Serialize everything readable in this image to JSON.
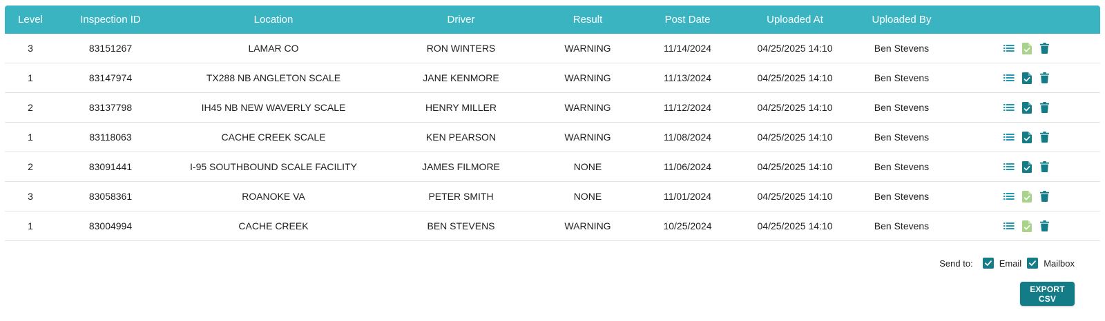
{
  "table": {
    "columns": [
      "Level",
      "Inspection ID",
      "Location",
      "Driver",
      "Result",
      "Post Date",
      "Uploaded At",
      "Uploaded By",
      ""
    ],
    "rows": [
      {
        "level": "3",
        "id": "83151267",
        "location": "LAMAR CO",
        "driver": "RON WINTERS",
        "result": "WARNING",
        "post_date": "11/14/2024",
        "uploaded_at": "04/25/2025 14:10",
        "uploaded_by": "Ben Stevens",
        "report_state": "muted"
      },
      {
        "level": "1",
        "id": "83147974",
        "location": "TX288 NB ANGLETON SCALE",
        "driver": "JANE KENMORE",
        "result": "WARNING",
        "post_date": "11/13/2024",
        "uploaded_at": "04/25/2025 14:10",
        "uploaded_by": "Ben Stevens",
        "report_state": "active"
      },
      {
        "level": "2",
        "id": "83137798",
        "location": "IH45 NB NEW WAVERLY SCALE",
        "driver": "HENRY MILLER",
        "result": "WARNING",
        "post_date": "11/12/2024",
        "uploaded_at": "04/25/2025 14:10",
        "uploaded_by": "Ben Stevens",
        "report_state": "active"
      },
      {
        "level": "1",
        "id": "83118063",
        "location": "CACHE CREEK SCALE",
        "driver": "KEN PEARSON",
        "result": "WARNING",
        "post_date": "11/08/2024",
        "uploaded_at": "04/25/2025 14:10",
        "uploaded_by": "Ben Stevens",
        "report_state": "active"
      },
      {
        "level": "2",
        "id": "83091441",
        "location": "I-95 SOUTHBOUND SCALE FACILITY",
        "driver": "JAMES FILMORE",
        "result": "NONE",
        "post_date": "11/06/2024",
        "uploaded_at": "04/25/2025 14:10",
        "uploaded_by": "Ben Stevens",
        "report_state": "active"
      },
      {
        "level": "3",
        "id": "83058361",
        "location": "ROANOKE VA",
        "driver": "PETER SMITH",
        "result": "NONE",
        "post_date": "11/01/2024",
        "uploaded_at": "04/25/2025 14:10",
        "uploaded_by": "Ben Stevens",
        "report_state": "muted"
      },
      {
        "level": "1",
        "id": "83004994",
        "location": "CACHE CREEK",
        "driver": "BEN STEVENS",
        "result": "WARNING",
        "post_date": "10/25/2024",
        "uploaded_at": "04/25/2025 14:10",
        "uploaded_by": "Ben Stevens",
        "report_state": "muted"
      }
    ],
    "action_icons": [
      "list-icon",
      "report-check-icon",
      "trash-icon"
    ]
  },
  "send_to": {
    "label": "Send to:",
    "options": [
      {
        "label": "Email",
        "checked": true
      },
      {
        "label": "Mailbox",
        "checked": true
      }
    ]
  },
  "export_label": "EXPORT CSV",
  "colors": {
    "header_bg": "#3ab4c1",
    "accent": "#137c87",
    "list_icon": "#1f9ab0",
    "report_active": "#137c87",
    "report_muted": "#a9d38a"
  }
}
